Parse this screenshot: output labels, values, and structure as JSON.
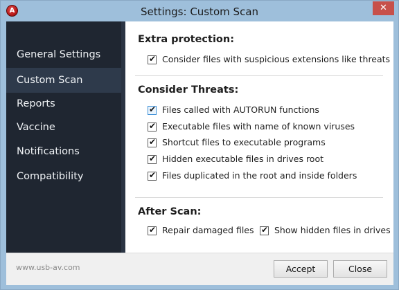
{
  "window": {
    "title": "Settings: Custom Scan",
    "app_icon_glyph": "A",
    "close_glyph": "✕"
  },
  "sidebar": {
    "items": [
      {
        "label": "General Settings"
      },
      {
        "label": "Custom Scan",
        "active": true
      },
      {
        "label": "Reports"
      },
      {
        "label": "Vaccine"
      },
      {
        "label": "Notifications"
      },
      {
        "label": "Compatibility"
      }
    ]
  },
  "sections": {
    "extra": {
      "heading": "Extra protection:",
      "options": [
        {
          "label": "Consider files with suspicious extensions like threats",
          "checked": true
        }
      ]
    },
    "threats": {
      "heading": "Consider Threats:",
      "options": [
        {
          "label": "Files called with AUTORUN functions",
          "checked": true
        },
        {
          "label": "Executable files with name of known viruses",
          "checked": true
        },
        {
          "label": "Shortcut files to executable programs",
          "checked": true
        },
        {
          "label": "Hidden executable files in drives root",
          "checked": true
        },
        {
          "label": "Files duplicated in the root and inside folders",
          "checked": true
        }
      ]
    },
    "after": {
      "heading": "After Scan:",
      "options": [
        {
          "label": "Repair damaged files",
          "checked": true
        },
        {
          "label": "Show hidden files in drives",
          "checked": true
        }
      ]
    }
  },
  "footer": {
    "site": "www.usb-av.com",
    "accept_label": "Accept",
    "close_label": "Close"
  },
  "icons": {
    "checkmark": "✔"
  },
  "colors": {
    "sidebar_bg": "#1f2631",
    "title_bar": "#9ebfdb",
    "close_button": "#c7504a"
  }
}
